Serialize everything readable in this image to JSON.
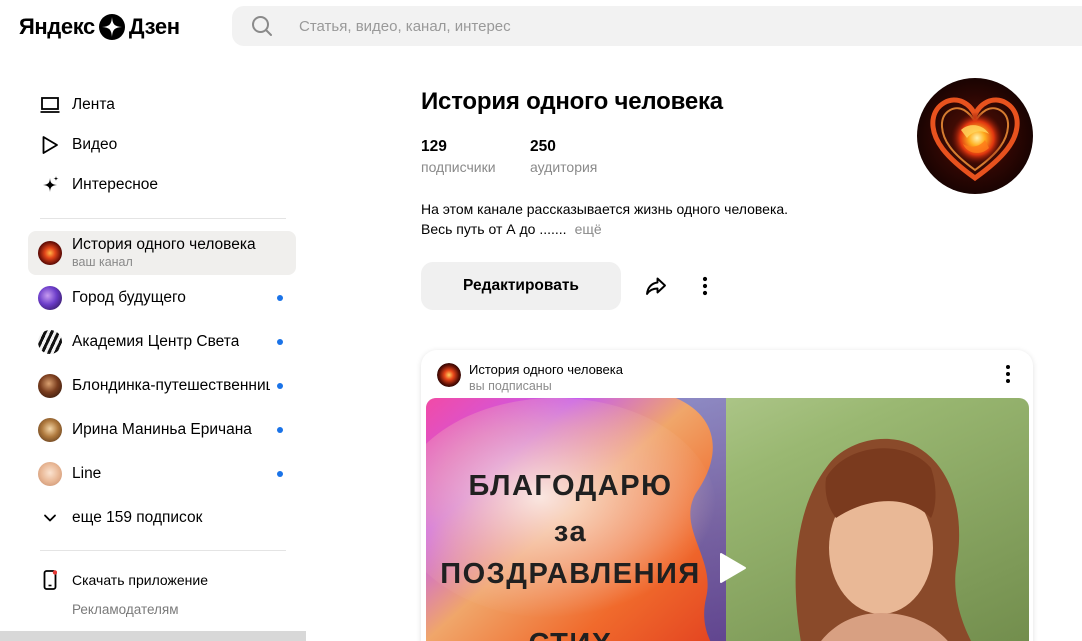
{
  "header": {
    "logo_left": "Яндекс",
    "logo_right": "Дзен",
    "search_placeholder": "Статья, видео, канал, интерес"
  },
  "sidebar": {
    "nav": [
      {
        "label": "Лента",
        "icon": "laptop-icon"
      },
      {
        "label": "Видео",
        "icon": "play-outline-icon"
      },
      {
        "label": "Интересное",
        "icon": "sparkle-icon"
      }
    ],
    "subscriptions": [
      {
        "name": "История одного человека",
        "sub": "ваш канал",
        "active": true,
        "unread": false
      },
      {
        "name": "Город будущего",
        "unread": true
      },
      {
        "name": "Академия Центр Света",
        "unread": true
      },
      {
        "name": "Блондинка-путешественница",
        "unread": true
      },
      {
        "name": "Ирина Маниньа Еричана",
        "unread": true
      },
      {
        "name": "Line",
        "unread": true
      }
    ],
    "more_subs": "еще 159 подписок",
    "app_link": "Скачать приложение",
    "advertisers": "Рекламодателям"
  },
  "channel": {
    "title": "История одного человека",
    "subscribers_count": "129",
    "subscribers_label": "подписчики",
    "audience_count": "250",
    "audience_label": "аудитория",
    "description_line1": "На этом канале рассказывается жизнь одного человека.",
    "description_line2": "Весь путь от А до .......",
    "description_more": "ещё",
    "edit_label": "Редактировать"
  },
  "post": {
    "channel_name": "История одного человека",
    "status": "вы подписаны",
    "thumb_line1": "БЛАГОДАРЮ",
    "thumb_line2": "за",
    "thumb_line3": "ПОЗДРАВЛЕНИЯ",
    "thumb_line4": "СТИХ"
  },
  "colors": {
    "unread_dot": "#1a73e8",
    "active_bg": "#f0efed",
    "button_bg": "#f0f0f0"
  }
}
